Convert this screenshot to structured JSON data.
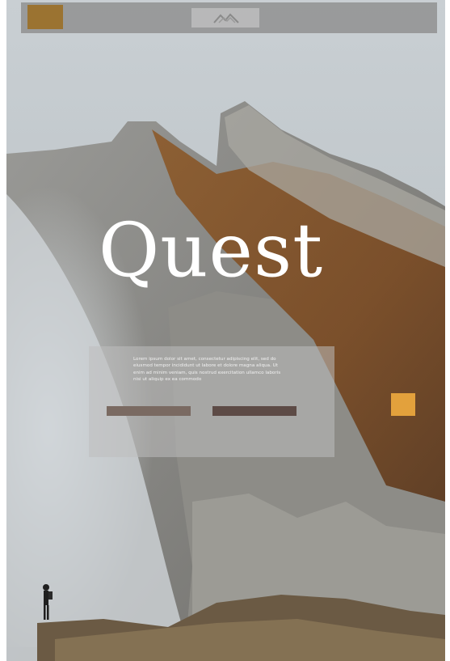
{
  "brand": {
    "color": "#9b7331"
  },
  "logo": {
    "icon": "mountain-logo-icon"
  },
  "hero": {
    "title": "Quest",
    "body": "Lorem ipsum dolor sit amet, consectetur adipiscing elit, sed do eiusmod tempor incididunt ut labore et dolore magna aliqua. Ut enim ad minim veniam, quis nostrud exercitation ullamco laboris nisi ut aliquip ex ea commodo"
  },
  "buttons": {
    "primary_color": "#7a6a62",
    "secondary_color": "#5d4b46"
  },
  "accent": {
    "color": "#e3a13c"
  }
}
